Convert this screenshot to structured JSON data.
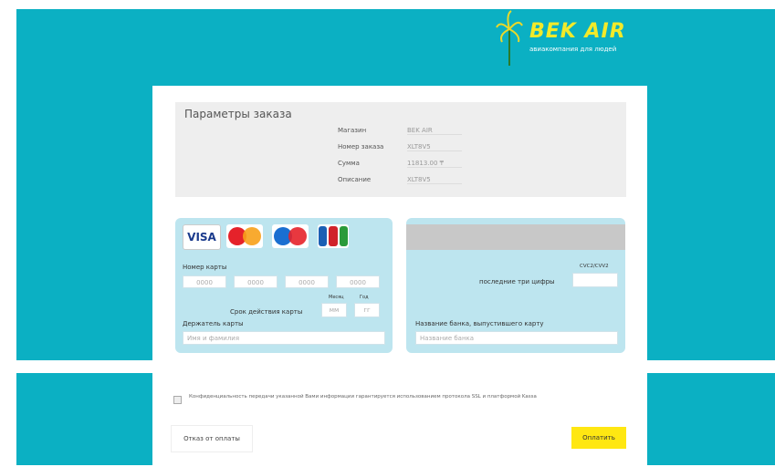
{
  "header": {
    "logo_text": "BEK AIR",
    "logo_slogan": "авиакомпания для людей"
  },
  "order": {
    "title": "Параметры заказа",
    "rows": [
      {
        "label": "Магазин",
        "value": "BEK AIR"
      },
      {
        "label": "Номер заказа",
        "value": "XLT8V5"
      },
      {
        "label": "Сумма",
        "value": "11813.00 ₸"
      },
      {
        "label": "Описание",
        "value": "XLT8V5"
      }
    ]
  },
  "card_front": {
    "logos": [
      "VISA",
      "MasterCard",
      "Maestro",
      "JCB"
    ],
    "card_number_label": "Номер карты",
    "card_number_placeholders": [
      "0000",
      "0000",
      "0000",
      "0000"
    ],
    "expiry_label": "Срок действия карты",
    "month_label": "Месяц",
    "year_label": "Год",
    "month_placeholder": "мм",
    "year_placeholder": "гг",
    "holder_label": "Держатель карты",
    "holder_placeholder": "Имя и фамилия"
  },
  "card_back": {
    "cvc_label": "CVC2/CVV2",
    "cvc_hint": "последние три цифры",
    "bank_label": "Название банка, выпустившего карту",
    "bank_placeholder": "Название банка"
  },
  "footer": {
    "consent_text": "Конфиденциальность передачи указанной Вами информации гарантируется использованием протокола SSL и платформой Kassa",
    "refuse_label": "Отказ от оплаты",
    "pay_label": "Оплатить"
  },
  "colors": {
    "background": "#0bb0c3",
    "accent_yellow": "#ffe712",
    "card_bg": "#bde5ef"
  }
}
